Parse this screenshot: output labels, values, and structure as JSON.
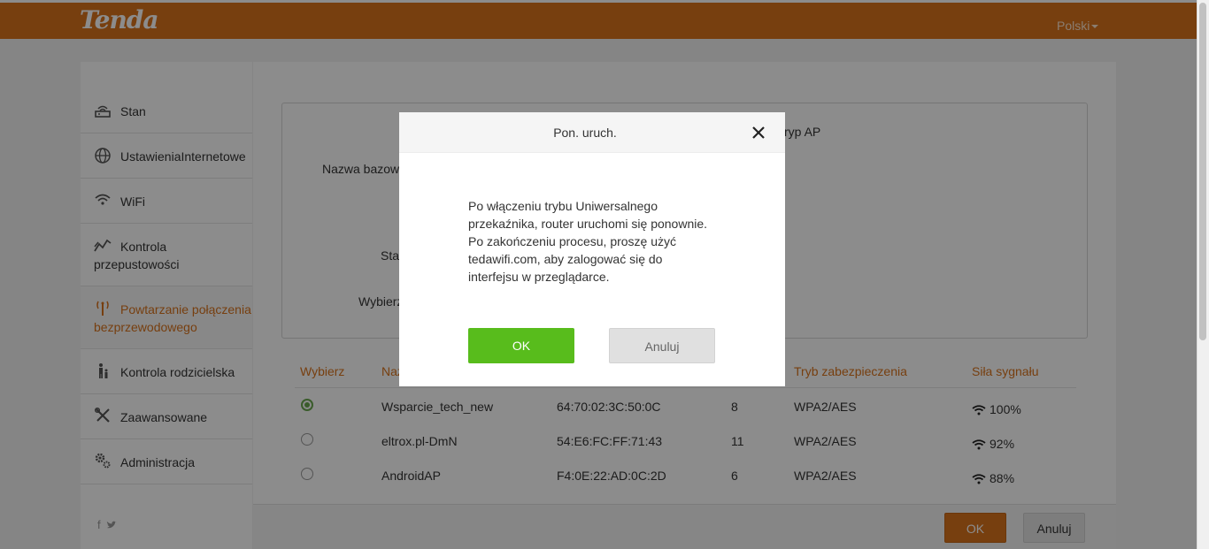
{
  "header": {
    "logo": "Tenda",
    "language": "Polski"
  },
  "sidebar": {
    "items": [
      {
        "label": "Stan",
        "icon": "router-icon"
      },
      {
        "label": "UstawieniaInternetowe",
        "icon": "globe-icon"
      },
      {
        "label": "WiFi",
        "icon": "wifi-icon"
      },
      {
        "label": "Kontrola przepustowości",
        "icon": "bandwidth-icon"
      },
      {
        "label": "Powtarzanie połączenia bezprzewodowego",
        "icon": "repeater-icon",
        "active": true
      },
      {
        "label": "Kontrola rodzicielska",
        "icon": "parent-icon"
      },
      {
        "label": "Zaawansowane",
        "icon": "tools-icon"
      },
      {
        "label": "Administracja",
        "icon": "gears-icon"
      }
    ],
    "social": "f   t"
  },
  "form": {
    "visible_fragments": [
      "Nazwa bazow",
      "Sta",
      "Wybierz",
      "ryp AP"
    ]
  },
  "table": {
    "headers": [
      "Wybierz",
      "Naz",
      "Tryb zabezpieczenia",
      "Siła sygnału"
    ],
    "rows": [
      {
        "selected": true,
        "ssid": "Wsparcie_tech_new",
        "mac": "64:70:02:3C:50:0C",
        "channel": "8",
        "security": "WPA2/AES",
        "signal": "100%"
      },
      {
        "selected": false,
        "ssid": "eltrox.pl-DmN",
        "mac": "54:E6:FC:FF:71:43",
        "channel": "11",
        "security": "WPA2/AES",
        "signal": "92%"
      },
      {
        "selected": false,
        "ssid": "AndroidAP",
        "mac": "F4:0E:22:AD:0C:2D",
        "channel": "6",
        "security": "WPA2/AES",
        "signal": "88%"
      }
    ]
  },
  "footer": {
    "ok_label": "OK",
    "cancel_label": "Anuluj"
  },
  "modal": {
    "title": "Pon. uruch.",
    "lines": [
      "Po włączeniu trybu Uniwersalnego",
      "przekaźnika, router uruchomi się ponownie.",
      "Po zakończeniu procesu, proszę użyć",
      "tedawifi.com, aby zalogować się do",
      "interfejsu w przeglądarce."
    ],
    "ok_label": "OK",
    "cancel_label": "Anuluj"
  },
  "colors": {
    "brand": "#d9731d",
    "ok_green": "#58bc1c",
    "overlay": "rgba(0,0,0,0.45)"
  }
}
